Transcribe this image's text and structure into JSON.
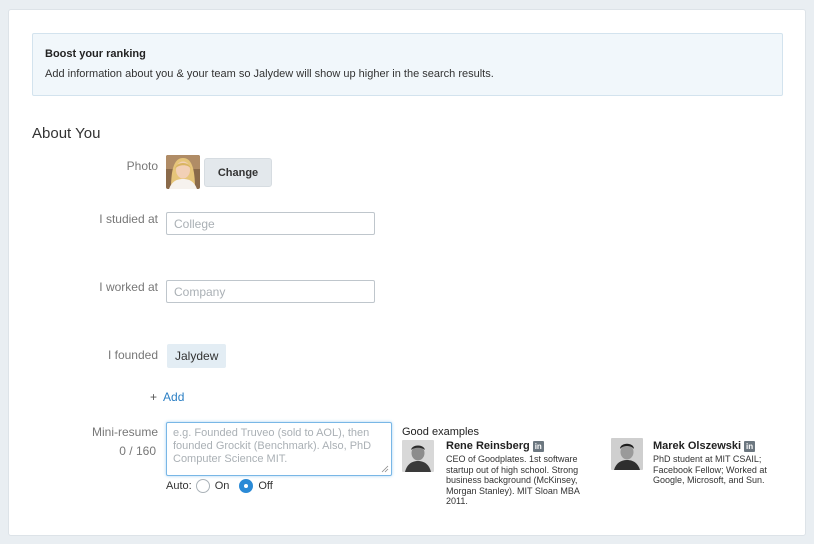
{
  "boost": {
    "title": "Boost your ranking",
    "text": "Add information about you & your team so Jalydew will show up higher in the search results."
  },
  "about": {
    "section_title": "About You",
    "photo_label": "Photo",
    "change_label": "Change",
    "studied_label": "I studied at",
    "studied_placeholder": "College",
    "studied_value": "",
    "worked_label": "I worked at",
    "worked_placeholder": "Company",
    "worked_value": "",
    "founded_label": "I founded",
    "founded_tag": "Jalydew",
    "add_plus": "+",
    "add_label": "Add",
    "resume_label": "Mini-resume",
    "resume_counter": "0 / 160",
    "resume_placeholder": "e.g. Founded Truveo (sold to AOL), then founded Grockit (Benchmark). Also, PhD Computer Science MIT.",
    "resume_value": "",
    "auto_label": "Auto:",
    "on_label": "On",
    "off_label": "Off",
    "auto_selected": "Off"
  },
  "examples": {
    "title": "Good examples",
    "items": [
      {
        "name": "Rene Reinsberg",
        "icon": "linkedin-icon",
        "description": "CEO of Goodplates. 1st software startup out of high school. Strong business background (McKinsey, Morgan Stanley). MIT Sloan MBA 2011."
      },
      {
        "name": "Marek Olszewski",
        "icon": "linkedin-icon",
        "description": "PhD student at MIT CSAIL; Facebook Fellow; Worked at Google, Microsoft, and Sun."
      }
    ],
    "linkedin_glyph": "in"
  },
  "colors": {
    "accent": "#2b8ad6",
    "link": "#2b7fc4",
    "boost_bg": "#f1f7fb",
    "page_bg": "#e9eef2"
  }
}
